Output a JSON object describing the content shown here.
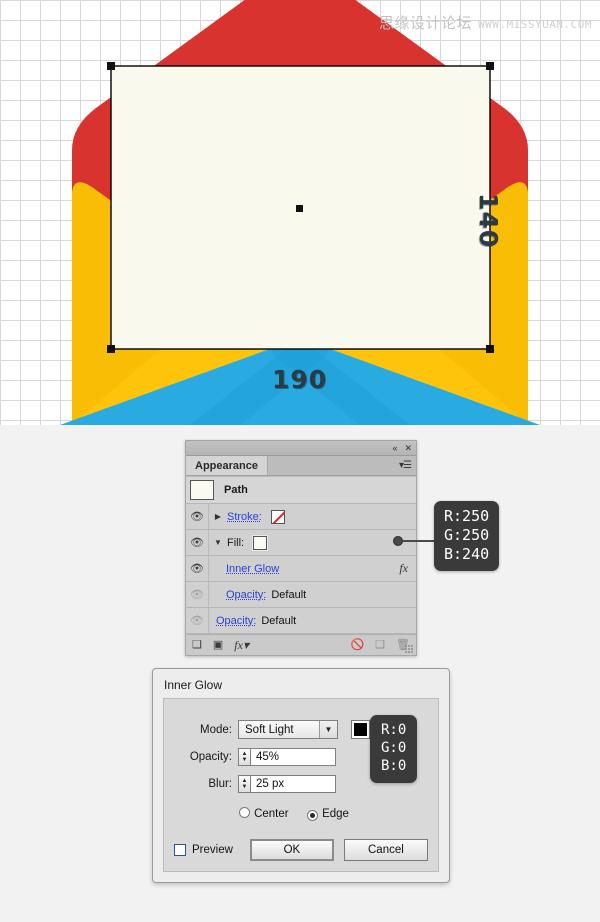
{
  "canvas": {
    "watermark_cn": "思缘设计论坛",
    "watermark_url": "WWW.MISSYUAN.COM",
    "dimension_width": "190",
    "dimension_height": "140",
    "colors": {
      "flap_red": "#d8332f",
      "envelope_yellow": "#fdc40b",
      "envelope_yellow_shade": "#f5b800",
      "card_blue": "#29abe2",
      "card_blue_shade": "#1b9fd8",
      "selection_fill": "#faf9ee",
      "dim_label": "#2b3a45"
    }
  },
  "appearance_panel": {
    "titlebar": {
      "collapse_icon": "«",
      "close_icon": "✕"
    },
    "tab_label": "Appearance",
    "menu_icon": "▾☰",
    "header_row": {
      "label": "Path"
    },
    "rows": [
      {
        "label": "Stroke:",
        "value": "",
        "visible": true,
        "disclosure": "▶",
        "swatch": "none",
        "fx": false
      },
      {
        "label": "Fill:",
        "value": "",
        "visible": true,
        "disclosure": "▼",
        "swatch": "cream",
        "fx": false
      },
      {
        "label": "Inner Glow",
        "value": "",
        "visible": true,
        "disclosure": "",
        "swatch": "",
        "fx": true
      },
      {
        "label": "Opacity:",
        "value": "Default",
        "visible": false,
        "disclosure": "",
        "swatch": "",
        "fx": false
      },
      {
        "label": "Opacity:",
        "value": "Default",
        "visible": false,
        "disclosure": "",
        "swatch": "",
        "fx": false
      }
    ],
    "footer_icons": [
      "add-new-fill",
      "add-new-stroke",
      "fx-menu",
      "clear-appearance",
      "duplicate-item",
      "delete-item"
    ],
    "footer_glyphs": {
      "add_fill": "❑",
      "add_stroke": "▣",
      "fx": "fx▾",
      "clear": "🚫",
      "duplicate": "❏",
      "delete": "🗑"
    }
  },
  "fill_color_callout": {
    "r": "R:250",
    "g": "G:250",
    "b": "B:240"
  },
  "glow_color_callout": {
    "r": "R:0",
    "g": "G:0",
    "b": "B:0"
  },
  "inner_glow_dialog": {
    "title": "Inner Glow",
    "mode_label": "Mode:",
    "mode_value": "Soft Light",
    "mode_arrow": "▼",
    "opacity_label": "Opacity:",
    "opacity_value": "45%",
    "blur_label": "Blur:",
    "blur_value": "25 px",
    "radio_center": "Center",
    "radio_edge": "Edge",
    "radio_selected": "Edge",
    "preview_label": "Preview",
    "preview_checked": false,
    "ok_label": "OK",
    "cancel_label": "Cancel"
  }
}
